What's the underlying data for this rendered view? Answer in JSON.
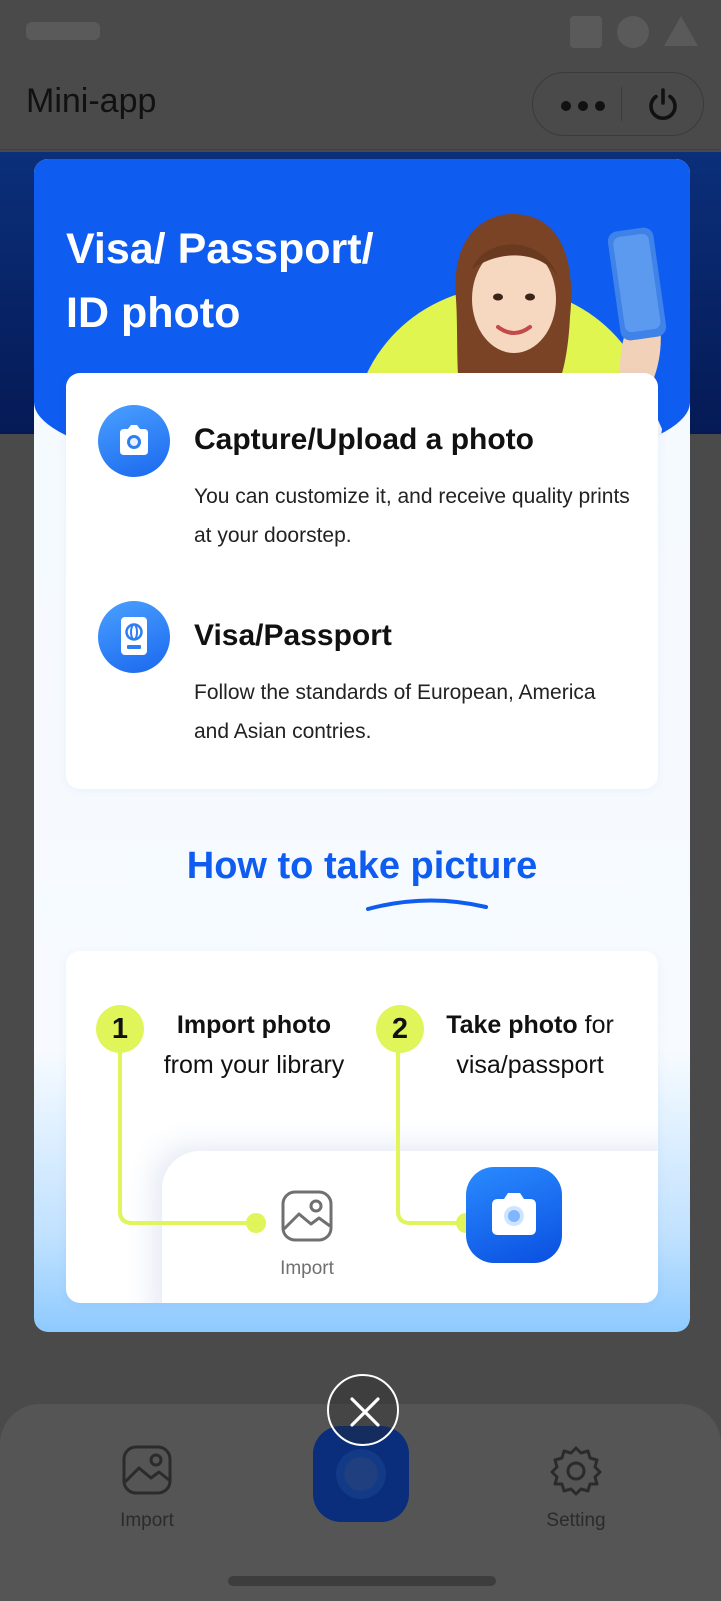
{
  "app": {
    "title": "Mini-app"
  },
  "modal": {
    "hero_title_line1": "Visa/ Passport/",
    "hero_title_line2": "ID photo",
    "features": [
      {
        "icon": "camera-icon",
        "title": "Capture/Upload a photo",
        "description": "You can customize it, and receive quality prints at your doorstep."
      },
      {
        "icon": "passport-icon",
        "title": "Visa/Passport",
        "description": "Follow the standards of European, America and Asian contries."
      }
    ],
    "how_to_title": "How to take picture",
    "steps": [
      {
        "number": "1",
        "bold": "Import photo",
        "rest": "from your library"
      },
      {
        "number": "2",
        "bold": "Take photo",
        "rest_inline": "for",
        "rest": "visa/passport"
      }
    ],
    "mock_import_label": "Import"
  },
  "bottom_nav": {
    "import_label": "Import",
    "setting_label": "Setting"
  },
  "colors": {
    "brand_blue": "#0f5cf0",
    "accent_lime": "#dff55a"
  }
}
